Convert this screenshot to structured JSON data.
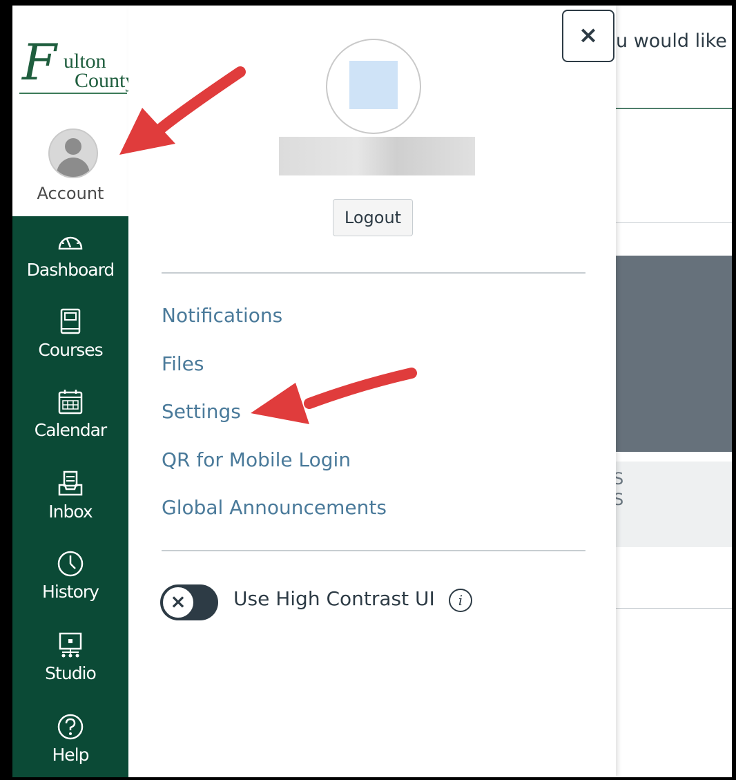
{
  "background_page": {
    "header_fragment": "u would like",
    "card_fragment_1": "S",
    "card_fragment_2": "S"
  },
  "logo": {
    "initial": "F",
    "line1": "ulton",
    "line2": "County"
  },
  "nav": {
    "account": "Account",
    "items": [
      {
        "label": "Dashboard",
        "icon": "dashboard-icon"
      },
      {
        "label": "Courses",
        "icon": "courses-icon"
      },
      {
        "label": "Calendar",
        "icon": "calendar-icon"
      },
      {
        "label": "Inbox",
        "icon": "inbox-icon"
      },
      {
        "label": "History",
        "icon": "history-icon"
      },
      {
        "label": "Studio",
        "icon": "studio-icon"
      },
      {
        "label": "Help",
        "icon": "help-icon"
      }
    ]
  },
  "tray": {
    "logout": "Logout",
    "links": [
      "Notifications",
      "Files",
      "Settings",
      "QR for Mobile Login",
      "Global Announcements"
    ],
    "high_contrast_label": "Use High Contrast UI",
    "high_contrast_enabled": false,
    "toggle_glyph": "×",
    "info_glyph": "i"
  },
  "close_glyph": "×",
  "colors": {
    "nav_bg": "#0b4a36",
    "link": "#4a7a9a",
    "arrow": "#e03c3c"
  }
}
